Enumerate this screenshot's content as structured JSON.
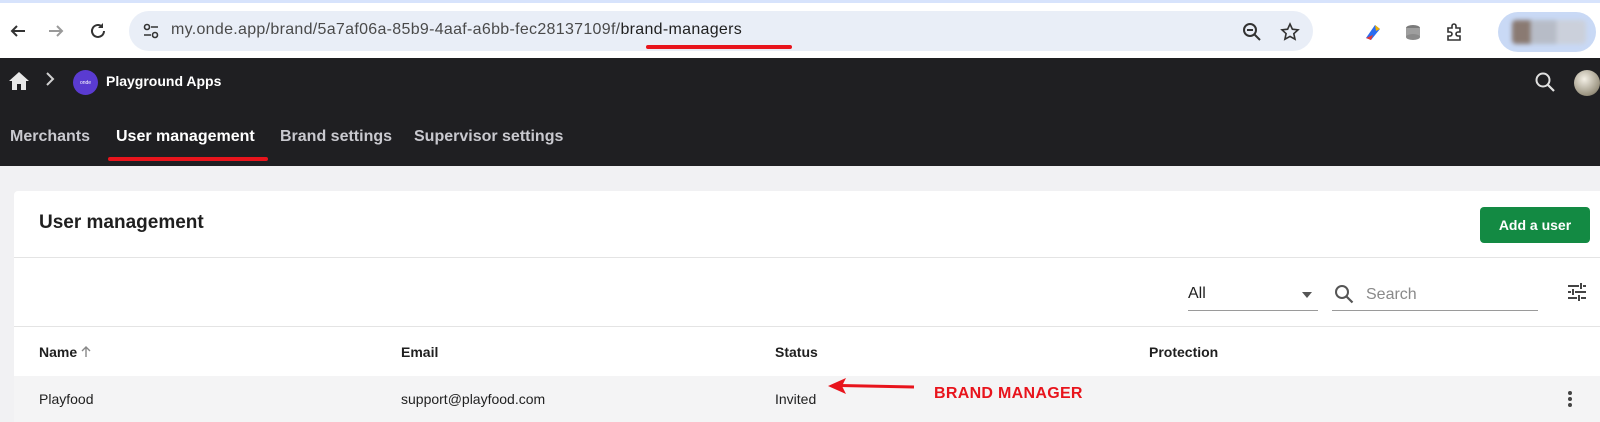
{
  "browser": {
    "url_main": "my.onde.app/brand/5a7af06a-85b9-4aaf-a6bb-fec28137109f/",
    "url_highlight": "brand-managers",
    "icons": [
      "back-icon",
      "forward-icon",
      "reload-icon",
      "site-settings-icon",
      "zoom-icon",
      "bookmark-star-icon",
      "extension-icon",
      "puzzle-icon",
      "profile-avatar"
    ]
  },
  "app": {
    "brand_name": "Playground Apps",
    "avatar_text": "onde",
    "tabs": [
      {
        "label": "Merchants",
        "active": false
      },
      {
        "label": "User management",
        "active": true
      },
      {
        "label": "Brand settings",
        "active": false
      },
      {
        "label": "Supervisor settings",
        "active": false
      }
    ]
  },
  "page": {
    "title": "User management",
    "add_button": "Add a user",
    "filter_value": "All",
    "search_placeholder": "Search",
    "columns": [
      "Name",
      "Email",
      "Status",
      "Protection"
    ],
    "rows": [
      {
        "name": "Playfood",
        "email": "support@playfood.com",
        "status": "Invited",
        "protection": ""
      }
    ]
  },
  "annotation": {
    "label": "BRAND MANAGER",
    "color": "#e8141c"
  },
  "colors": {
    "accent_green": "#138a43",
    "app_bar": "#1f1f22",
    "annotation_red": "#e8141c"
  }
}
